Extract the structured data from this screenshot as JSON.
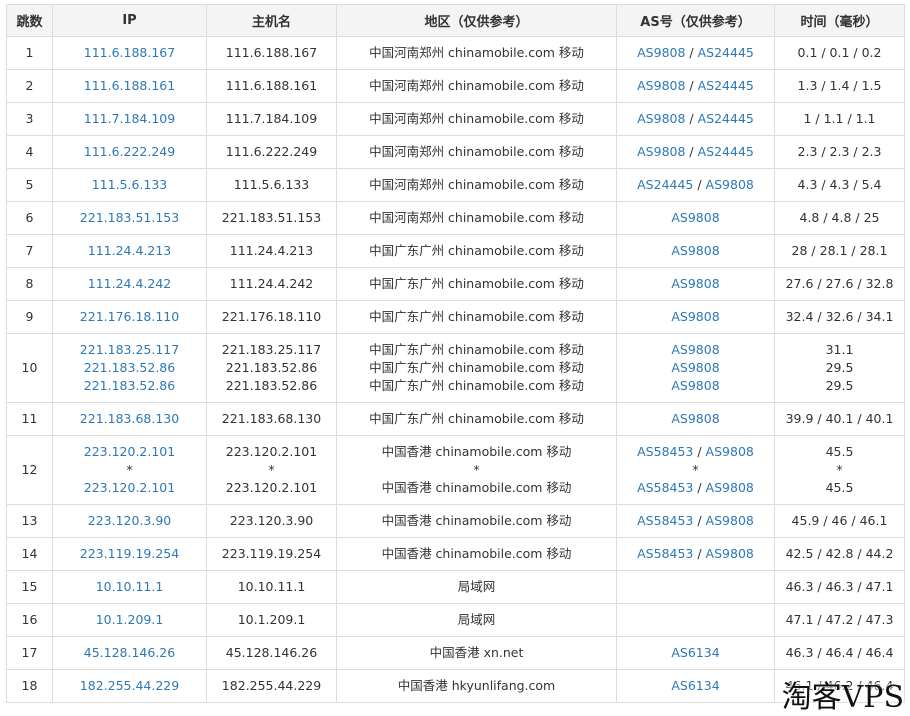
{
  "headers": {
    "hop": "跳数",
    "ip": "IP",
    "host": "主机名",
    "region": "地区（仅供参考）",
    "as": "AS号（仅供参考）",
    "time": "时间（毫秒）"
  },
  "rows": [
    {
      "hop": "1",
      "entries": [
        {
          "ip": "111.6.188.167",
          "host": "111.6.188.167",
          "region": "中国河南郑州 chinamobile.com 移动",
          "as": [
            "AS9808",
            "AS24445"
          ]
        }
      ],
      "time": [
        "0.1 / 0.1 / 0.2"
      ]
    },
    {
      "hop": "2",
      "entries": [
        {
          "ip": "111.6.188.161",
          "host": "111.6.188.161",
          "region": "中国河南郑州 chinamobile.com 移动",
          "as": [
            "AS9808",
            "AS24445"
          ]
        }
      ],
      "time": [
        "1.3 / 1.4 / 1.5"
      ]
    },
    {
      "hop": "3",
      "entries": [
        {
          "ip": "111.7.184.109",
          "host": "111.7.184.109",
          "region": "中国河南郑州 chinamobile.com 移动",
          "as": [
            "AS9808",
            "AS24445"
          ]
        }
      ],
      "time": [
        "1 / 1.1 / 1.1"
      ]
    },
    {
      "hop": "4",
      "entries": [
        {
          "ip": "111.6.222.249",
          "host": "111.6.222.249",
          "region": "中国河南郑州 chinamobile.com 移动",
          "as": [
            "AS9808",
            "AS24445"
          ]
        }
      ],
      "time": [
        "2.3 / 2.3 / 2.3"
      ]
    },
    {
      "hop": "5",
      "entries": [
        {
          "ip": "111.5.6.133",
          "host": "111.5.6.133",
          "region": "中国河南郑州 chinamobile.com 移动",
          "as": [
            "AS24445",
            "AS9808"
          ]
        }
      ],
      "time": [
        "4.3 / 4.3 / 5.4"
      ]
    },
    {
      "hop": "6",
      "entries": [
        {
          "ip": "221.183.51.153",
          "host": "221.183.51.153",
          "region": "中国河南郑州 chinamobile.com 移动",
          "as": [
            "AS9808"
          ]
        }
      ],
      "time": [
        "4.8 / 4.8 / 25"
      ]
    },
    {
      "hop": "7",
      "entries": [
        {
          "ip": "111.24.4.213",
          "host": "111.24.4.213",
          "region": "中国广东广州 chinamobile.com 移动",
          "as": [
            "AS9808"
          ]
        }
      ],
      "time": [
        "28 / 28.1 / 28.1"
      ]
    },
    {
      "hop": "8",
      "entries": [
        {
          "ip": "111.24.4.242",
          "host": "111.24.4.242",
          "region": "中国广东广州 chinamobile.com 移动",
          "as": [
            "AS9808"
          ]
        }
      ],
      "time": [
        "27.6 / 27.6 / 32.8"
      ]
    },
    {
      "hop": "9",
      "entries": [
        {
          "ip": "221.176.18.110",
          "host": "221.176.18.110",
          "region": "中国广东广州 chinamobile.com 移动",
          "as": [
            "AS9808"
          ]
        }
      ],
      "time": [
        "32.4 / 32.6 / 34.1"
      ]
    },
    {
      "hop": "10",
      "entries": [
        {
          "ip": "221.183.25.117",
          "host": "221.183.25.117",
          "region": "中国广东广州 chinamobile.com 移动",
          "as": [
            "AS9808"
          ]
        },
        {
          "ip": "221.183.52.86",
          "host": "221.183.52.86",
          "region": "中国广东广州 chinamobile.com 移动",
          "as": [
            "AS9808"
          ]
        },
        {
          "ip": "221.183.52.86",
          "host": "221.183.52.86",
          "region": "中国广东广州 chinamobile.com 移动",
          "as": [
            "AS9808"
          ]
        }
      ],
      "time": [
        "31.1",
        "29.5",
        "29.5"
      ]
    },
    {
      "hop": "11",
      "entries": [
        {
          "ip": "221.183.68.130",
          "host": "221.183.68.130",
          "region": "中国广东广州 chinamobile.com 移动",
          "as": [
            "AS9808"
          ]
        }
      ],
      "time": [
        "39.9 / 40.1 / 40.1"
      ]
    },
    {
      "hop": "12",
      "entries": [
        {
          "ip": "223.120.2.101",
          "host": "223.120.2.101",
          "region": "中国香港 chinamobile.com 移动",
          "as": [
            "AS58453",
            "AS9808"
          ]
        },
        {
          "ip": "*",
          "host": "*",
          "region": "*",
          "as": [
            "*"
          ]
        },
        {
          "ip": "223.120.2.101",
          "host": "223.120.2.101",
          "region": "中国香港 chinamobile.com 移动",
          "as": [
            "AS58453",
            "AS9808"
          ]
        }
      ],
      "time": [
        "45.5",
        "*",
        "45.5"
      ]
    },
    {
      "hop": "13",
      "entries": [
        {
          "ip": "223.120.3.90",
          "host": "223.120.3.90",
          "region": "中国香港 chinamobile.com 移动",
          "as": [
            "AS58453",
            "AS9808"
          ]
        }
      ],
      "time": [
        "45.9 / 46 / 46.1"
      ]
    },
    {
      "hop": "14",
      "entries": [
        {
          "ip": "223.119.19.254",
          "host": "223.119.19.254",
          "region": "中国香港 chinamobile.com 移动",
          "as": [
            "AS58453",
            "AS9808"
          ]
        }
      ],
      "time": [
        "42.5 / 42.8 / 44.2"
      ]
    },
    {
      "hop": "15",
      "entries": [
        {
          "ip": "10.10.11.1",
          "host": "10.10.11.1",
          "region": "局域网",
          "as": []
        }
      ],
      "time": [
        "46.3 / 46.3 / 47.1"
      ]
    },
    {
      "hop": "16",
      "entries": [
        {
          "ip": "10.1.209.1",
          "host": "10.1.209.1",
          "region": "局域网",
          "as": []
        }
      ],
      "time": [
        "47.1 / 47.2 / 47.3"
      ]
    },
    {
      "hop": "17",
      "entries": [
        {
          "ip": "45.128.146.26",
          "host": "45.128.146.26",
          "region": "中国香港 xn.net",
          "as": [
            "AS6134"
          ]
        }
      ],
      "time": [
        "46.3 / 46.4 / 46.4"
      ]
    },
    {
      "hop": "18",
      "entries": [
        {
          "ip": "182.255.44.229",
          "host": "182.255.44.229",
          "region": "中国香港 hkyunlifang.com",
          "as": [
            "AS6134"
          ]
        }
      ],
      "time": [
        "46.1 / 46.2 / 46.4"
      ]
    }
  ],
  "watermark": "淘客VPS",
  "colors": {
    "link": "#2e78b7",
    "text": "#333333",
    "border": "#dcdcdc",
    "header_bg": "#f4f4f4"
  }
}
